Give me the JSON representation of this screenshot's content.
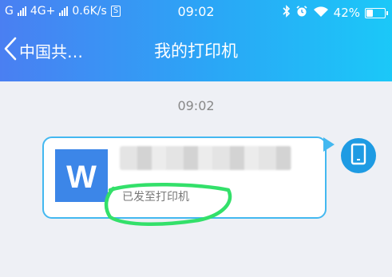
{
  "status_bar": {
    "carrier1": "G",
    "carrier2": "4G+",
    "speed": "0.6K/s",
    "sim_badge": "S",
    "time": "09:02",
    "battery": "42%",
    "battery_level": 0.42
  },
  "nav": {
    "back_label": "中国共…",
    "title": "我的打印机"
  },
  "chat": {
    "timestamp": "09:02",
    "message": {
      "file_icon_letter": "W",
      "file_name": "",
      "status": "已发至打印机"
    },
    "sender_icon": "phone-device-icon"
  },
  "colors": {
    "header_gradient_start": "#4a7ff2",
    "header_gradient_end": "#1bc8f8",
    "bubble_border": "#43b8f0",
    "word_icon": "#3c86e8",
    "avatar": "#1e9be3",
    "annotation": "#33e06a",
    "background": "#eef0f5"
  }
}
